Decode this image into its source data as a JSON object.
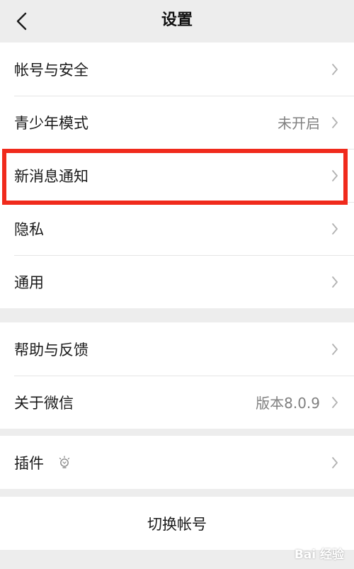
{
  "header": {
    "title": "设置"
  },
  "groups": [
    {
      "items": [
        {
          "label": "帐号与安全",
          "value": ""
        },
        {
          "label": "青少年模式",
          "value": "未开启"
        },
        {
          "label": "新消息通知",
          "value": ""
        },
        {
          "label": "隐私",
          "value": ""
        },
        {
          "label": "通用",
          "value": ""
        }
      ]
    },
    {
      "items": [
        {
          "label": "帮助与反馈",
          "value": ""
        },
        {
          "label": "关于微信",
          "value": "版本8.0.9"
        }
      ]
    },
    {
      "items": [
        {
          "label": "插件",
          "value": ""
        }
      ]
    }
  ],
  "actions": {
    "switch_account": "切换帐号"
  },
  "highlighted_item": "新消息通知",
  "watermark": "Bai 经验",
  "colors": {
    "background": "#ededed",
    "highlight": "#f02a1c",
    "secondary_text": "#808080"
  },
  "icons": {
    "back": "chevron-left-icon",
    "row": "chevron-right-icon",
    "plugin": "lightbulb-icon"
  }
}
